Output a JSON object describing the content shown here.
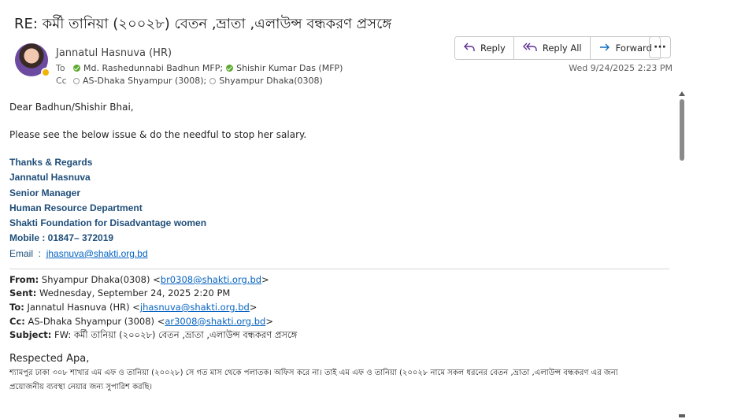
{
  "subject": "RE: কর্মী তানিয়া (২০০২৮) বেতন ,ভ্রাতা ,এলাউন্স বন্ধকরণ প্রসঙ্গে",
  "sender": {
    "name": "Jannatul Hasnuva (HR)"
  },
  "to": {
    "label": "To",
    "recipients": [
      "Md. Rashedunnabi Badhun MFP;",
      "Shishir Kumar Das (MFP)"
    ]
  },
  "cc": {
    "label": "Cc",
    "recipients": [
      "AS-Dhaka Shyampur (3008);",
      "Shyampur Dhaka(0308)"
    ]
  },
  "actions": {
    "reply": "Reply",
    "reply_all": "Reply All",
    "forward": "Forward"
  },
  "date": "Wed 9/24/2025 2:23 PM",
  "body": {
    "greeting": "Dear Badhun/Shishir Bhai,",
    "message": "Please see the below issue & do the needful to stop her salary.",
    "signature": {
      "line1": "Thanks & Regards",
      "line2": "Jannatul Hasnuva",
      "line3": "Senior Manager",
      "line4": "Human Resource Department",
      "line5": "Shakti Foundation for Disadvantage women",
      "line6": "Mobile : 01847– 372019",
      "email_label": "Email  :  ",
      "email": "jhasnuva@shakti.org.bd"
    }
  },
  "forwarded": {
    "from_label": "From:",
    "from_name": " Shyampur Dhaka(0308) <",
    "from_email": "br0308@shakti.org.bd",
    "sent_label": "Sent:",
    "sent": " Wednesday, September 24, 2025 2:20 PM",
    "to_label": "To:",
    "to_name": " Jannatul Hasnuva (HR) <",
    "to_email": "jhasnuva@shakti.org.bd",
    "cc_label": "Cc:",
    "cc_name": " AS-Dhaka Shyampur (3008) <",
    "cc_email": "ar3008@shakti.org.bd",
    "subject_label": "Subject:",
    "subject": " FW: কর্মী তানিয়া (২০০২৮) বেতন ,ভ্রাতা ,এলাউন্স বন্ধকরণ প্রসঙ্গে",
    "salutation": "Respected Apa,",
    "line1": "শ্যামপুর ঢাকা ৩০৮ শাখার এম এফ ও তানিয়া (২০০২৮) সে গত মাস থেকে পলাতক। অফিস করে না। তাই এম এফ ও তানিয়া (২০০২৮ নামে সকল ধরনের বেতন ,ভ্রাতা ,এলাউন্স বন্ধকরণ এর জন্য",
    "line2": "প্রয়োজনীয় ব্যবস্থা নেয়ার জন্য সুপারিশ করছি।"
  }
}
